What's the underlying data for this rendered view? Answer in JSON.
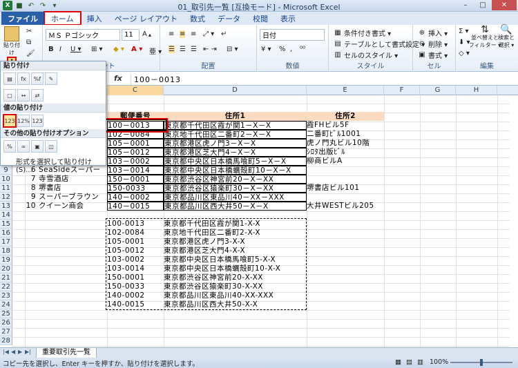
{
  "window": {
    "title": "01_取引先一覧 [互換モード] - Microsoft Excel",
    "quick_access": [
      "excel-logo",
      "save-icon",
      "undo-icon",
      "redo-icon",
      "customize-icon"
    ],
    "controls": [
      "minimize",
      "maximize",
      "close"
    ]
  },
  "tabs": [
    "ファイル",
    "ホーム",
    "挿入",
    "ページ レイアウト",
    "数式",
    "データ",
    "校閲",
    "表示"
  ],
  "ribbon": {
    "clipboard": {
      "label": "貼り付け",
      "paste": "貼り付け"
    },
    "font": {
      "name": "ＭＳ Ｐゴシック",
      "size": "11",
      "label": "フォント"
    },
    "alignment": {
      "label": "配置"
    },
    "number": {
      "format": "日付",
      "label": "数値",
      "percent": "%",
      "comma": ","
    },
    "styles": {
      "label": "スタイル",
      "conditional": "条件付き書式 ▾",
      "table": "テーブルとして書式設定 ▾",
      "cell": "セルのスタイル ▾"
    },
    "cells": {
      "label": "セル",
      "insert": "挿入 ▾",
      "delete": "削除 ▾",
      "format": "書式 ▾"
    },
    "editing": {
      "label": "編集",
      "sigma": "Σ ▾",
      "sort": "並べ替えと\nフィルター ▾",
      "find": "検索と\n選択 ▾"
    }
  },
  "paste_menu": {
    "section1": "貼り付け",
    "section2": "値の貼り付け",
    "section3": "その他の貼り付けオプション",
    "special": "形式を選択して貼り付け(S)..."
  },
  "formula_bar": {
    "fx": "fx",
    "value": "100－0013"
  },
  "columns": [
    "C",
    "D",
    "E",
    "F",
    "G",
    "H"
  ],
  "rows": [
    "9",
    "10",
    "11",
    "12",
    "13",
    "14",
    "15",
    "16",
    "17",
    "18",
    "19",
    "20",
    "21",
    "22",
    "23",
    "24",
    "25",
    "26",
    "27",
    "28"
  ],
  "table": {
    "headers": {
      "zip": "郵便番号",
      "addr1": "住所1",
      "addr2": "住所2"
    },
    "rows": [
      {
        "zip": "100－0013",
        "addr1": "東京都千代田区霞が関1－X－X",
        "addr2": "霞FHビル5F"
      },
      {
        "zip": "102－0084",
        "addr1": "東京地千代田区二番町2－X－X",
        "addr2": "二番町ﾋﾞﾙ1001"
      },
      {
        "zip": "105－0001",
        "addr1": "東京都港区虎ノ門3－X－X",
        "addr2": "虎ノ門丸ビル10階"
      },
      {
        "zip": "105－0012",
        "addr1": "東京都港区芝大門4－X－X",
        "addr2": "ｼﾛﾀ出版ﾋﾞﾙ"
      },
      {
        "zip": "103－0002",
        "addr1": "東京都中央区日本橋馬喰町5－X－X",
        "addr2": "柳商ビルA"
      },
      {
        "num": "6",
        "name": "SeaSideスーパー",
        "zip": "103－0014",
        "addr1": "東京都中央区日本橋蠣殻町10－X－X",
        "addr2": ""
      },
      {
        "num": "7",
        "name": "寺雪酒店",
        "zip": "150－0001",
        "addr1": "東京都渋谷区神宮前20－X－XX",
        "addr2": ""
      },
      {
        "num": "8",
        "name": "堺書店",
        "zip": "150-0033",
        "addr1": "東京都渋谷区猿楽町30－X－XX",
        "addr2": "堺書店ビル101"
      },
      {
        "num": "9",
        "name": "スーパーブラウン",
        "zip": "140－0002",
        "addr1": "東京都品川区東品川40－XX－XXX",
        "addr2": ""
      },
      {
        "num": "10",
        "name": "クイーン商会",
        "zip": "140－0015",
        "addr1": "東京都品川区西大井50－X－X",
        "addr2": "大井WESTビル205"
      }
    ]
  },
  "pasted": [
    {
      "zip": "100-0013",
      "addr1": "東京都千代田区霞が関1-X-X"
    },
    {
      "zip": "102-0084",
      "addr1": "東京地千代田区二番町2-X-X"
    },
    {
      "zip": "105-0001",
      "addr1": "東京都港区虎ノ門3-X-X"
    },
    {
      "zip": "105-0012",
      "addr1": "東京都港区芝大門4-X-X"
    },
    {
      "zip": "103-0002",
      "addr1": "東京都中央区日本橋馬喰町5-X-X"
    },
    {
      "zip": "103-0014",
      "addr1": "東京都中央区日本橋蠣殻町10-X-X"
    },
    {
      "zip": "150-0001",
      "addr1": "東京都渋谷区神宮前20-X-XX"
    },
    {
      "zip": "150-0033",
      "addr1": "東京都渋谷区猿楽町30-X-XX"
    },
    {
      "zip": "140-0002",
      "addr1": "東京都品川区東品川40-XX-XXX"
    },
    {
      "zip": "140-0015",
      "addr1": "東京都品川区西大井50-X-X"
    }
  ],
  "sheet_tab": "重要取引先一覧",
  "status": {
    "message": "コピー先を選択し、Enter キーを押すか、貼り付けを選択します。",
    "zoom": "100%"
  },
  "colors": {
    "accent": "#2a5fa9",
    "header_fill": "#fbdcc3",
    "highlight": "#e00000"
  }
}
